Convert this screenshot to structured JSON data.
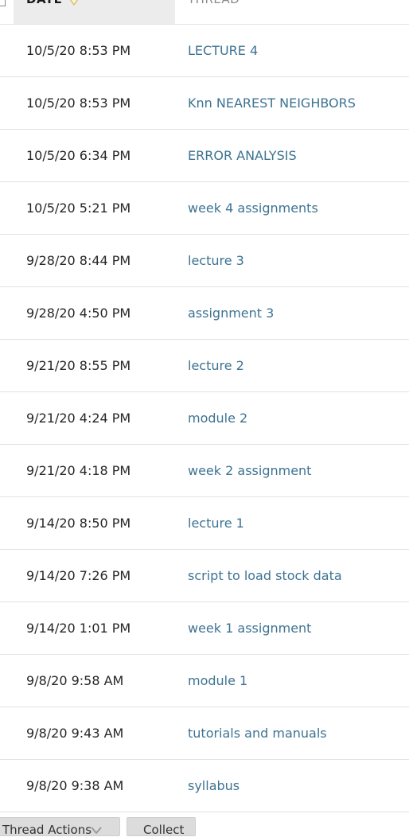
{
  "header": {
    "date_label": "DATE",
    "thread_label": "THREAD",
    "sort_icon": "sort-down-icon"
  },
  "rows": [
    {
      "date": "10/5/20 8:53 PM",
      "thread": "LECTURE 4"
    },
    {
      "date": "10/5/20 8:53 PM",
      "thread": "Knn NEAREST NEIGHBORS"
    },
    {
      "date": "10/5/20 6:34 PM",
      "thread": "ERROR ANALYSIS"
    },
    {
      "date": "10/5/20 5:21 PM",
      "thread": "week 4 assignments"
    },
    {
      "date": "9/28/20 8:44 PM",
      "thread": "lecture 3"
    },
    {
      "date": "9/28/20 4:50 PM",
      "thread": "assignment 3"
    },
    {
      "date": "9/21/20 8:55 PM",
      "thread": "lecture 2"
    },
    {
      "date": "9/21/20 4:24 PM",
      "thread": "module 2"
    },
    {
      "date": "9/21/20 4:18 PM",
      "thread": "week 2 assignment"
    },
    {
      "date": "9/14/20 8:50 PM",
      "thread": "lecture 1"
    },
    {
      "date": "9/14/20 7:26 PM",
      "thread": "script to load stock data"
    },
    {
      "date": "9/14/20 1:01 PM",
      "thread": "week 1 assignment"
    },
    {
      "date": "9/8/20 9:58 AM",
      "thread": "module 1"
    },
    {
      "date": "9/8/20 9:43 AM",
      "thread": "tutorials and manuals"
    },
    {
      "date": "9/8/20 9:38 AM",
      "thread": "syllabus"
    }
  ],
  "footer": {
    "thread_actions_label": "Thread Actions",
    "collect_label": "Collect"
  },
  "colors": {
    "link": "#3d7392",
    "header_bg": "#ececec",
    "divider": "#e2e2e2"
  }
}
